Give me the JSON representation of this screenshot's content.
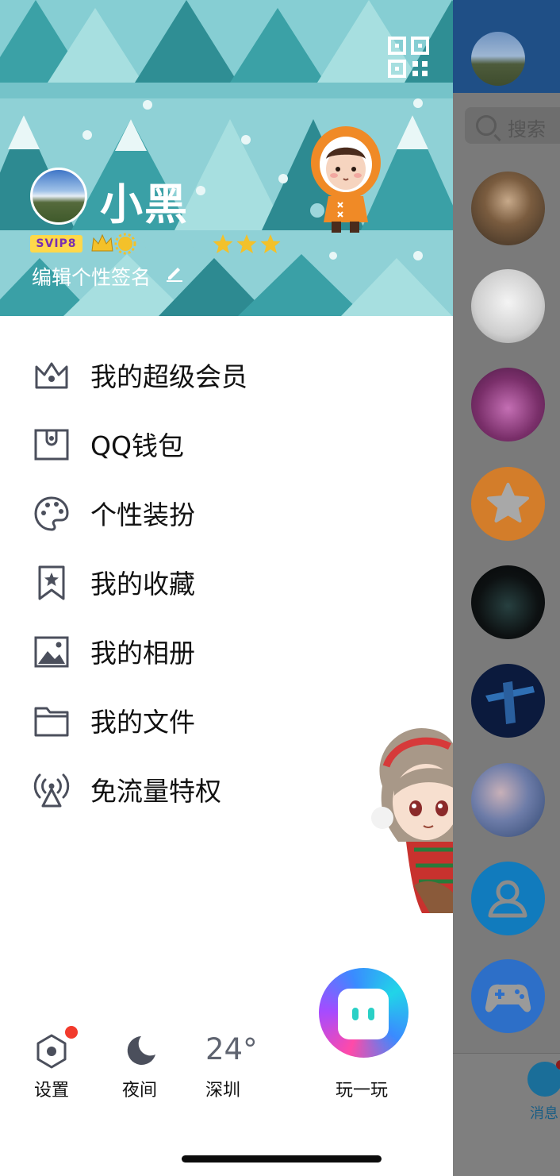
{
  "background_chat": {
    "search_placeholder": "搜索",
    "avatar_colors": [
      "#4a3d2e",
      "#d8d8d8",
      "#8a3d7a",
      "#d07a26",
      "#0c0d10",
      "#0c1b3c",
      "#5d6fa0",
      "#117bbd",
      "#2d6fc8"
    ],
    "tab_label": "消息"
  },
  "profile": {
    "name": "小黑",
    "vip_badge": "SVIP8",
    "signature_prompt": "编辑个性签名"
  },
  "menu": {
    "items": [
      {
        "label": "我的超级会员",
        "icon": "crown-icon"
      },
      {
        "label": "QQ钱包",
        "icon": "wallet-icon"
      },
      {
        "label": "个性装扮",
        "icon": "palette-icon"
      },
      {
        "label": "我的收藏",
        "icon": "bookmark-star-icon"
      },
      {
        "label": "我的相册",
        "icon": "photo-icon"
      },
      {
        "label": "我的文件",
        "icon": "folder-icon"
      },
      {
        "label": "免流量特权",
        "icon": "signal-tower-icon"
      }
    ]
  },
  "bottom": {
    "settings_label": "设置",
    "night_label": "夜间",
    "temperature": "24°",
    "city": "深圳",
    "play_label": "玩一玩"
  },
  "colors": {
    "icon_gray": "#4b4f5c",
    "banner_teal": "#8fd1d6",
    "notification_red": "#f23a2c"
  }
}
